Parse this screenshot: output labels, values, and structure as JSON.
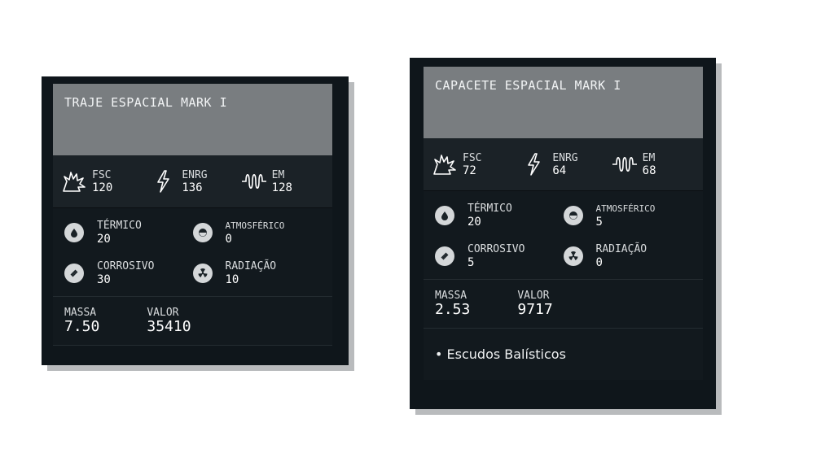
{
  "cards": [
    {
      "title": "TRAJE ESPACIAL MARK I",
      "stats": [
        {
          "icon": "explosion-icon",
          "label": "FSC",
          "value": "120"
        },
        {
          "icon": "lightning-icon",
          "label": "ENRG",
          "value": "136"
        },
        {
          "icon": "em-wave-icon",
          "label": "EM",
          "value": "128"
        }
      ],
      "resistances": [
        {
          "icon": "thermal-drop-icon",
          "label": "TÉRMICO",
          "value": "20"
        },
        {
          "icon": "atmosphere-icon",
          "label": "ATMOSFÉRICO",
          "value": "0"
        },
        {
          "icon": "corrosive-icon",
          "label": "CORROSIVO",
          "value": "30"
        },
        {
          "icon": "radiation-icon",
          "label": "RADIAÇÃO",
          "value": "10"
        }
      ],
      "mass_label": "MASSA",
      "mass": "7.50",
      "value_label": "VALOR",
      "value": "35410"
    },
    {
      "title": "CAPACETE ESPACIAL MARK I",
      "stats": [
        {
          "icon": "explosion-icon",
          "label": "FSC",
          "value": "72"
        },
        {
          "icon": "lightning-icon",
          "label": "ENRG",
          "value": "64"
        },
        {
          "icon": "em-wave-icon",
          "label": "EM",
          "value": "68"
        }
      ],
      "resistances": [
        {
          "icon": "thermal-drop-icon",
          "label": "TÉRMICO",
          "value": "20"
        },
        {
          "icon": "atmosphere-icon",
          "label": "ATMOSFÉRICO",
          "value": "5"
        },
        {
          "icon": "corrosive-icon",
          "label": "CORROSIVO",
          "value": "5"
        },
        {
          "icon": "radiation-icon",
          "label": "RADIAÇÃO",
          "value": "0"
        }
      ],
      "mass_label": "MASSA",
      "mass": "2.53",
      "value_label": "VALOR",
      "value": "9717",
      "feature": "• Escudos Balísticos"
    }
  ]
}
